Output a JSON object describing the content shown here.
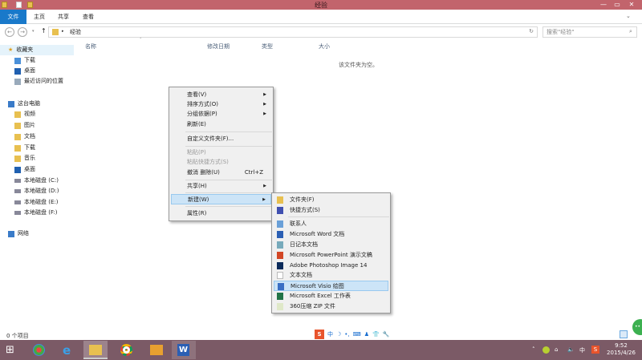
{
  "window": {
    "title": "经验"
  },
  "ribbon": {
    "tabs": [
      "文件",
      "主页",
      "共享",
      "查看"
    ]
  },
  "address": {
    "path": "经验",
    "search_placeholder": "搜索\"经验\""
  },
  "sidebar": {
    "favorites": "收藏夹",
    "fav_items": [
      "下载",
      "桌面",
      "最近访问的位置"
    ],
    "pc": "这台电脑",
    "pc_items": [
      "视频",
      "图片",
      "文档",
      "下载",
      "音乐",
      "桌面",
      "本地磁盘 (C:)",
      "本地磁盘 (D:)",
      "本地磁盘 (E:)",
      "本地磁盘 (F:)"
    ],
    "network": "网络"
  },
  "columns": [
    "名称",
    "修改日期",
    "类型",
    "大小"
  ],
  "empty_text": "该文件夹为空。",
  "status": "0 个项目",
  "menu": {
    "items": [
      {
        "label": "查看(V)"
      },
      {
        "label": "排序方式(O)"
      },
      {
        "label": "分组依据(P)"
      },
      {
        "label": "刷新(E)"
      },
      {
        "label": "自定义文件夹(F)..."
      },
      {
        "label": "粘贴(P)"
      },
      {
        "label": "粘贴快捷方式(S)"
      },
      {
        "label": "撤消 删除(U)",
        "shortcut": "Ctrl+Z"
      },
      {
        "label": "共享(H)"
      },
      {
        "label": "新建(W)"
      },
      {
        "label": "属性(R)"
      }
    ]
  },
  "submenu": {
    "items": [
      "文件夹(F)",
      "快捷方式(S)",
      "联系人",
      "Microsoft Word 文档",
      "日记本文档",
      "Microsoft PowerPoint 演示文稿",
      "Adobe Photoshop Image 14",
      "文本文档",
      "Microsoft Visio 绘图",
      "Microsoft Excel 工作表",
      "360压缩 ZIP 文件"
    ]
  },
  "ime": {
    "label": "中"
  },
  "tray": {
    "ime": "中",
    "time": "9:52",
    "date": "2015/4/26"
  },
  "colors": {
    "titlebar": "#c2646c",
    "taskbar": "#7b5a66",
    "accent": "#1979ca",
    "highlight": "#cce4f7"
  }
}
